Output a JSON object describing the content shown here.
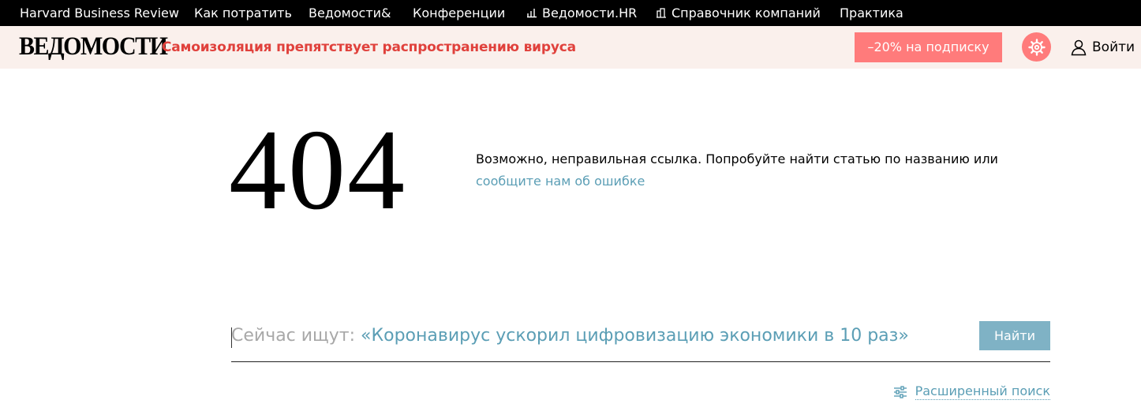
{
  "topnav": {
    "items": [
      {
        "label": "Harvard Business Review"
      },
      {
        "label": "Как потратить"
      },
      {
        "label": "Ведомости&"
      },
      {
        "label": "Конференции"
      },
      {
        "label": "Ведомости.HR",
        "icon": "chart-icon"
      },
      {
        "label": "Справочник компаний",
        "icon": "building-icon"
      },
      {
        "label": "Практика"
      }
    ]
  },
  "header": {
    "logo": "ВЕДОМОСТИ",
    "headline": "Самоизоляция препятствует распространению вируса",
    "subscribe_label": "–20% на подписку",
    "settings_icon": "gear-icon",
    "login_label": "Войти",
    "login_icon": "user-icon"
  },
  "error": {
    "code": "404",
    "message": "Возможно, неправильная ссылка. Попробуйте найти статью по названию или",
    "report_link": "сообщите нам об ошибке"
  },
  "search": {
    "prefix": "Сейчас ищут: ",
    "query": "«Коронавирус ускорил цифровизацию экономики в 10 раз»",
    "button_label": "Найти"
  },
  "advanced_search": {
    "label": "Расширенный поиск",
    "icon": "sliders-icon"
  },
  "colors": {
    "accent_red": "#e0413c",
    "subscribe_bg": "#ff7b7b",
    "link_blue": "#5b9eb5",
    "button_blue": "#7fb2c5",
    "header_bg": "#faf0ec"
  }
}
